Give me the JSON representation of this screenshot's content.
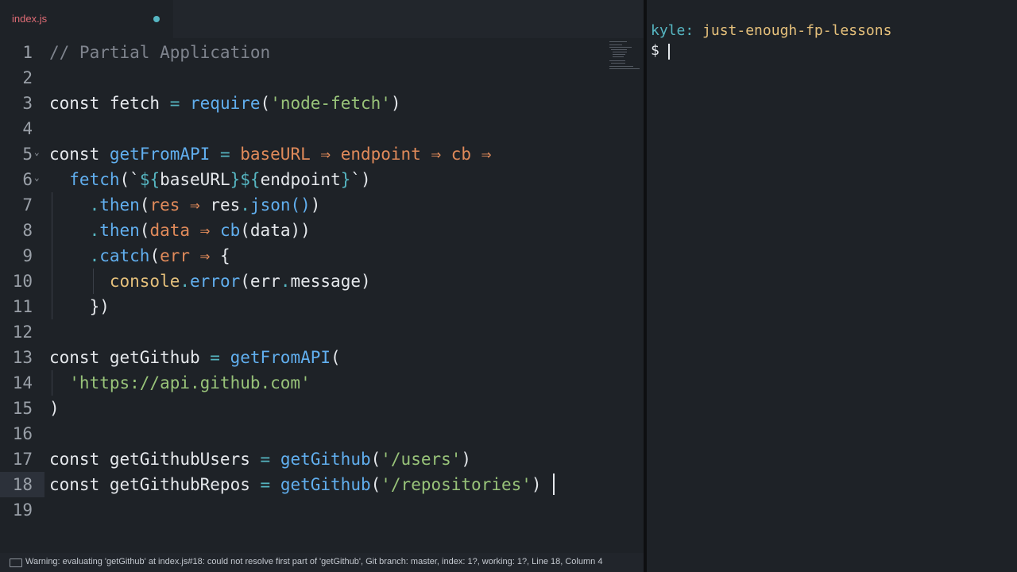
{
  "editor": {
    "tab": {
      "filename": "index.js"
    },
    "lines": [
      {
        "n": "1",
        "tokens": [
          {
            "t": "// Partial Application",
            "c": "com"
          }
        ]
      },
      {
        "n": "2",
        "tokens": []
      },
      {
        "n": "3",
        "tokens": [
          {
            "t": "const ",
            "c": "kw"
          },
          {
            "t": "fetch",
            "c": "kw"
          },
          {
            "t": " = ",
            "c": "op"
          },
          {
            "t": "require",
            "c": "fn"
          },
          {
            "t": "(",
            "c": "kw"
          },
          {
            "t": "'node-fetch'",
            "c": "str"
          },
          {
            "t": ")",
            "c": "kw"
          }
        ]
      },
      {
        "n": "4",
        "tokens": []
      },
      {
        "n": "5",
        "fold": "⌄",
        "tokens": [
          {
            "t": "const ",
            "c": "kw"
          },
          {
            "t": "getFromAPI",
            "c": "fn"
          },
          {
            "t": " = ",
            "c": "op"
          },
          {
            "t": "baseURL",
            "c": "prm"
          },
          {
            "t": " ⇒ ",
            "c": "prm"
          },
          {
            "t": "endpoint",
            "c": "prm"
          },
          {
            "t": " ⇒ ",
            "c": "prm"
          },
          {
            "t": "cb",
            "c": "prm"
          },
          {
            "t": " ⇒",
            "c": "prm"
          }
        ]
      },
      {
        "n": "6",
        "fold": "⌄",
        "tokens": [
          {
            "t": "  fetch",
            "c": "fn"
          },
          {
            "t": "(`",
            "c": "kw"
          },
          {
            "t": "${",
            "c": "op"
          },
          {
            "t": "baseURL",
            "c": "kw"
          },
          {
            "t": "}${",
            "c": "op"
          },
          {
            "t": "endpoint",
            "c": "kw"
          },
          {
            "t": "}",
            "c": "op"
          },
          {
            "t": "`)",
            "c": "kw"
          }
        ]
      },
      {
        "n": "7",
        "tokens": [
          {
            "t": "    .",
            "c": "op"
          },
          {
            "t": "then",
            "c": "fn"
          },
          {
            "t": "(",
            "c": "kw"
          },
          {
            "t": "res",
            "c": "prm"
          },
          {
            "t": " ⇒ ",
            "c": "prm"
          },
          {
            "t": "res",
            "c": "kw"
          },
          {
            "t": ".",
            "c": "op"
          },
          {
            "t": "json",
            "c": "fn"
          },
          {
            "t": "()",
            "c": "fn"
          },
          {
            "t": ")",
            "c": "kw"
          }
        ]
      },
      {
        "n": "8",
        "tokens": [
          {
            "t": "    .",
            "c": "op"
          },
          {
            "t": "then",
            "c": "fn"
          },
          {
            "t": "(",
            "c": "kw"
          },
          {
            "t": "data",
            "c": "prm"
          },
          {
            "t": " ⇒ ",
            "c": "prm"
          },
          {
            "t": "cb",
            "c": "fn"
          },
          {
            "t": "(data))",
            "c": "kw"
          }
        ]
      },
      {
        "n": "9",
        "tokens": [
          {
            "t": "    .",
            "c": "op"
          },
          {
            "t": "catch",
            "c": "fn"
          },
          {
            "t": "(",
            "c": "kw"
          },
          {
            "t": "err",
            "c": "prm"
          },
          {
            "t": " ⇒ ",
            "c": "prm"
          },
          {
            "t": "{",
            "c": "kw"
          }
        ]
      },
      {
        "n": "10",
        "tokens": [
          {
            "t": "      console",
            "c": "ylw"
          },
          {
            "t": ".",
            "c": "op"
          },
          {
            "t": "error",
            "c": "fn"
          },
          {
            "t": "(err",
            "c": "kw"
          },
          {
            "t": ".",
            "c": "op"
          },
          {
            "t": "message)",
            "c": "kw"
          }
        ]
      },
      {
        "n": "11",
        "tokens": [
          {
            "t": "    })",
            "c": "kw"
          }
        ]
      },
      {
        "n": "12",
        "tokens": []
      },
      {
        "n": "13",
        "tokens": [
          {
            "t": "const ",
            "c": "kw"
          },
          {
            "t": "getGithub",
            "c": "kw"
          },
          {
            "t": " = ",
            "c": "op"
          },
          {
            "t": "getFromAPI",
            "c": "fn"
          },
          {
            "t": "(",
            "c": "kw"
          }
        ]
      },
      {
        "n": "14",
        "tokens": [
          {
            "t": "  'https://api.github.com'",
            "c": "str"
          }
        ]
      },
      {
        "n": "15",
        "tokens": [
          {
            "t": ")",
            "c": "kw"
          }
        ]
      },
      {
        "n": "16",
        "tokens": []
      },
      {
        "n": "17",
        "tokens": [
          {
            "t": "const ",
            "c": "kw"
          },
          {
            "t": "getGithubUsers",
            "c": "kw"
          },
          {
            "t": " = ",
            "c": "op"
          },
          {
            "t": "getGithub",
            "c": "fn"
          },
          {
            "t": "(",
            "c": "kw"
          },
          {
            "t": "'/users'",
            "c": "str"
          },
          {
            "t": ")",
            "c": "kw"
          }
        ]
      },
      {
        "n": "18",
        "tokens": [
          {
            "t": "const ",
            "c": "kw"
          },
          {
            "t": "getGithubRepos",
            "c": "kw"
          },
          {
            "t": " = ",
            "c": "op"
          },
          {
            "t": "getGithub",
            "c": "fn"
          },
          {
            "t": "(",
            "c": "kw"
          },
          {
            "t": "'/repositories'",
            "c": "str"
          },
          {
            "t": ")",
            "c": "kw"
          }
        ]
      },
      {
        "n": "19",
        "tokens": []
      }
    ],
    "status": "Warning: evaluating 'getGithub' at index.js#18: could not resolve first part of 'getGithub', Git branch: master, index: 1?, working: 1?, Line 18, Column 4"
  },
  "terminal": {
    "user": "kyle:",
    "directory": "just-enough-fp-lessons",
    "prompt": "$"
  },
  "colors": {
    "background": "#1e2227",
    "keyword": "#e5e8ec",
    "function": "#61afef",
    "string": "#98c379",
    "parameter": "#e08a5a",
    "operator": "#56b6c2",
    "comment": "#7f848e",
    "console": "#e5c07b",
    "tab_filename": "#e06c75",
    "terminal_user": "#56b6c2",
    "terminal_directory": "#e5c07b"
  }
}
